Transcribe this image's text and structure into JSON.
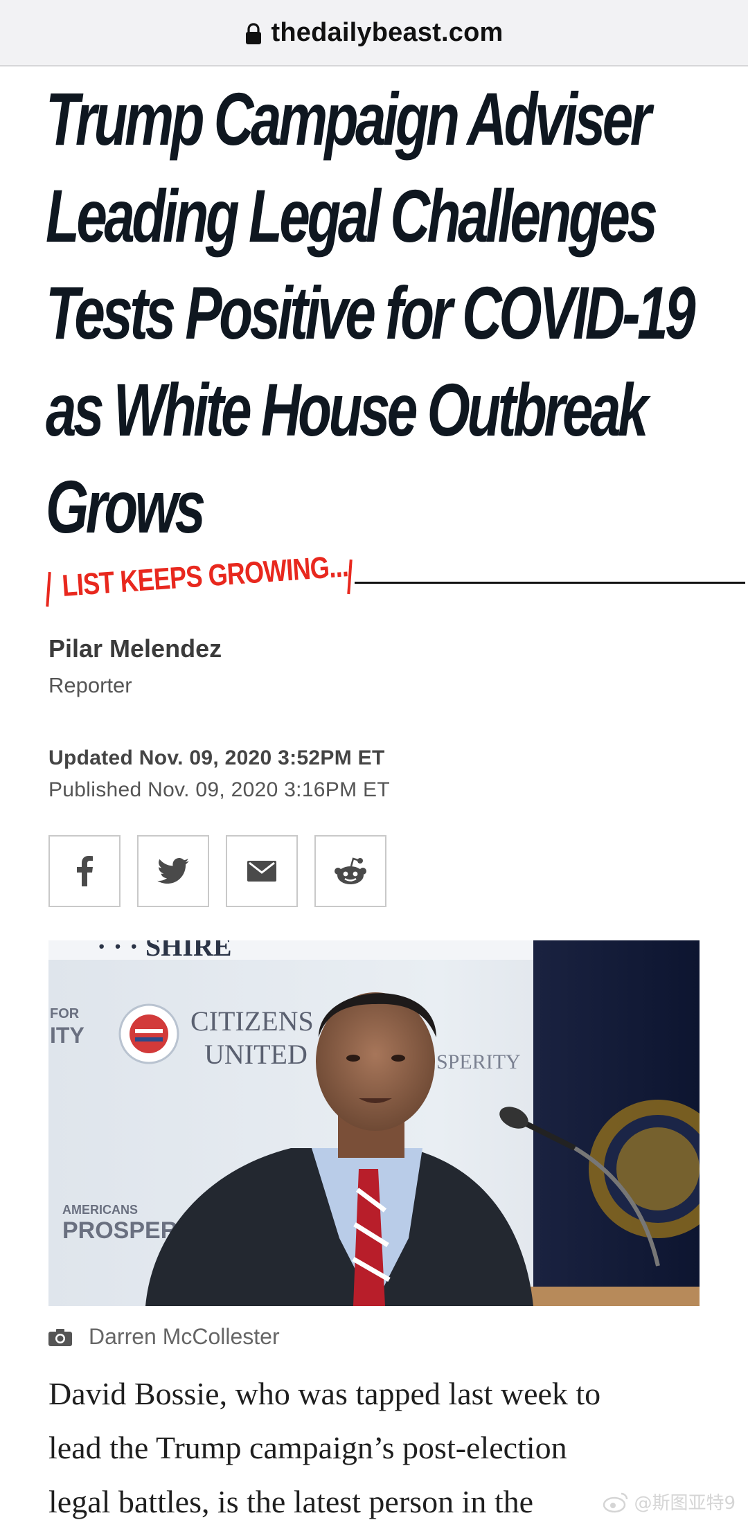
{
  "browser": {
    "domain": "thedailybeast.com",
    "lock_icon": "lock-icon"
  },
  "article": {
    "headline_lines": [
      "Trump Campaign Adviser",
      "Leading Legal Challenges",
      "Tests Positive for COVID-19",
      "as White House Outbreak",
      "Grows"
    ],
    "kicker": "LIST KEEPS GROWING...",
    "kicker_color": "#e8281e",
    "author": {
      "name": "Pilar Melendez",
      "role": "Reporter"
    },
    "updated": "Updated Nov. 09, 2020 3:52PM ET",
    "published": "Published Nov. 09, 2020 3:16PM ET",
    "share_buttons": [
      {
        "icon": "facebook-icon"
      },
      {
        "icon": "twitter-icon"
      },
      {
        "icon": "email-icon"
      },
      {
        "icon": "reddit-icon"
      }
    ],
    "photo": {
      "backdrop_text": [
        "CITIZENS",
        "UNITED",
        "AMERICANS",
        "PROSPER",
        "FOR",
        "ITY",
        "SPERITY"
      ]
    },
    "photo_credit": "Darren McCollester",
    "body_lines": [
      "David Bossie, who was tapped last week to",
      "lead the Trump campaign’s post-election",
      "legal battles, is the latest person in the"
    ]
  },
  "watermark": {
    "text": "@斯图亚特9"
  }
}
